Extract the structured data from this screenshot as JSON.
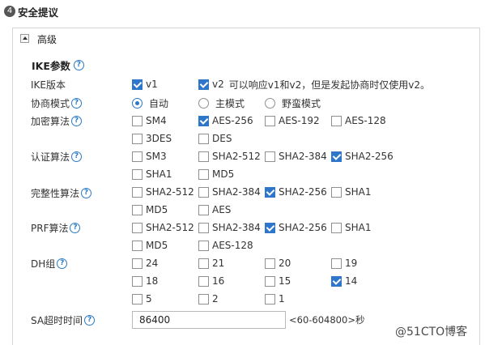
{
  "section": {
    "step_number": "4",
    "label": "安全提议"
  },
  "advanced": {
    "label": "高级"
  },
  "ike": {
    "title": "IKE参数",
    "version": {
      "label": "IKE版本",
      "v1_label": "v1",
      "v1_checked": true,
      "v2_label": "v2",
      "v2_checked": true,
      "v2_note": "可以响应v1和v2，但是发起协商时仅使用v2。"
    },
    "mode": {
      "label": "协商模式",
      "options": [
        "自动",
        "主模式",
        "野蛮模式"
      ],
      "selected": "自动"
    },
    "encryption": {
      "label": "加密算法",
      "options": [
        {
          "label": "SM4",
          "checked": false
        },
        {
          "label": "AES-256",
          "checked": true
        },
        {
          "label": "AES-192",
          "checked": false
        },
        {
          "label": "AES-128",
          "checked": false
        },
        {
          "label": "3DES",
          "checked": false
        },
        {
          "label": "DES",
          "checked": false
        }
      ]
    },
    "authentication": {
      "label": "认证算法",
      "options": [
        {
          "label": "SM3",
          "checked": false
        },
        {
          "label": "SHA2-512",
          "checked": false
        },
        {
          "label": "SHA2-384",
          "checked": false
        },
        {
          "label": "SHA2-256",
          "checked": true
        },
        {
          "label": "SHA1",
          "checked": false
        },
        {
          "label": "MD5",
          "checked": false
        }
      ]
    },
    "integrity": {
      "label": "完整性算法",
      "options": [
        {
          "label": "SHA2-512",
          "checked": false
        },
        {
          "label": "SHA2-384",
          "checked": false
        },
        {
          "label": "SHA2-256",
          "checked": true
        },
        {
          "label": "SHA1",
          "checked": false
        },
        {
          "label": "MD5",
          "checked": false
        },
        {
          "label": "AES",
          "checked": false
        }
      ]
    },
    "prf": {
      "label": "PRF算法",
      "options": [
        {
          "label": "SHA2-512",
          "checked": false
        },
        {
          "label": "SHA2-384",
          "checked": false
        },
        {
          "label": "SHA2-256",
          "checked": true
        },
        {
          "label": "SHA1",
          "checked": false
        },
        {
          "label": "MD5",
          "checked": false
        },
        {
          "label": "AES-128",
          "checked": false
        }
      ]
    },
    "dh": {
      "label": "DH组",
      "options": [
        {
          "label": "24",
          "checked": false
        },
        {
          "label": "21",
          "checked": false
        },
        {
          "label": "20",
          "checked": false
        },
        {
          "label": "19",
          "checked": false
        },
        {
          "label": "18",
          "checked": false
        },
        {
          "label": "16",
          "checked": false
        },
        {
          "label": "15",
          "checked": false
        },
        {
          "label": "14",
          "checked": true
        },
        {
          "label": "5",
          "checked": false
        },
        {
          "label": "2",
          "checked": false
        },
        {
          "label": "1",
          "checked": false
        }
      ]
    },
    "sa_timeout": {
      "label": "SA超时时间",
      "value": "86400",
      "range_hint": "<60-604800>秒"
    }
  },
  "watermark": "@51CTO博客",
  "colors": {
    "accent": "#2e76c9",
    "border": "#d6d6d6",
    "text": "#333333"
  },
  "icons": {
    "help": "question-circle-icon",
    "toggle": "collapse-triangle-icon",
    "step": "number-badge-icon"
  }
}
